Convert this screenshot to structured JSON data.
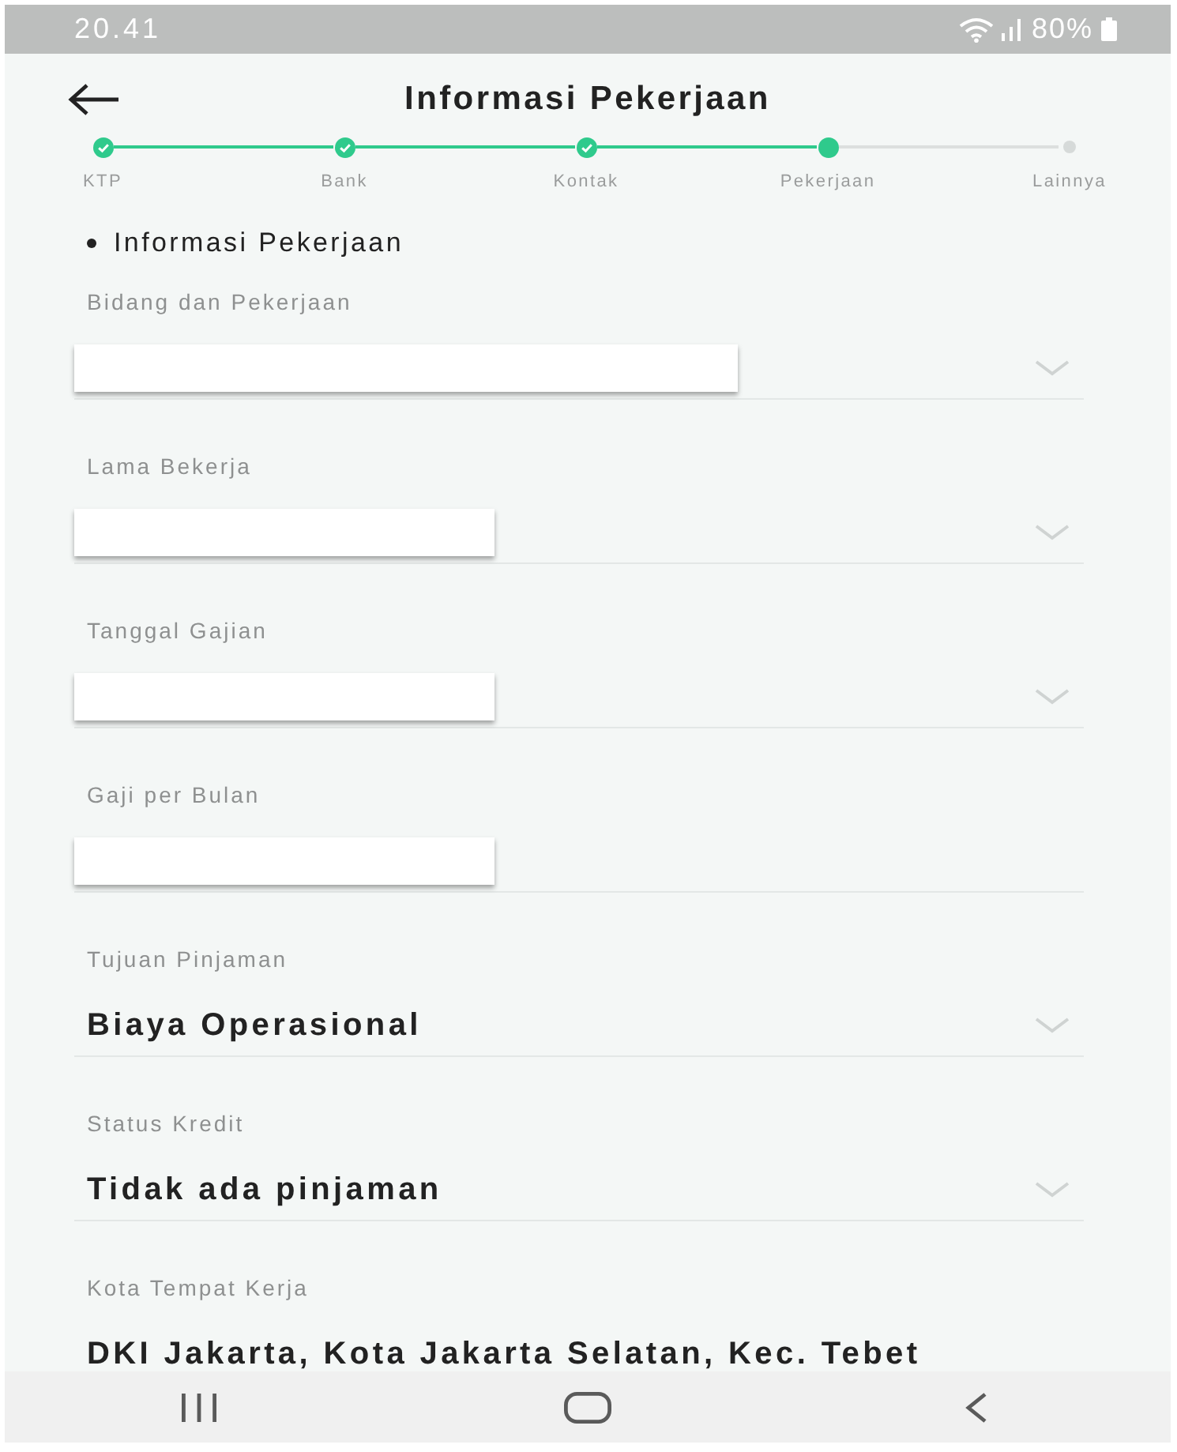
{
  "status_bar": {
    "time": "20.41",
    "battery": "80%"
  },
  "header": {
    "title": "Informasi Pekerjaan"
  },
  "steps": [
    {
      "label": "KTP",
      "kind": "done"
    },
    {
      "label": "Bank",
      "kind": "done"
    },
    {
      "label": "Kontak",
      "kind": "done"
    },
    {
      "label": "Pekerjaan",
      "kind": "current"
    },
    {
      "label": "Lainnya",
      "kind": "pending"
    }
  ],
  "section": {
    "heading": "Informasi Pekerjaan"
  },
  "fields": [
    {
      "label": "Bidang dan Pekerjaan",
      "kind": "dropdown",
      "redacted": true,
      "wide": true
    },
    {
      "label": "Lama Bekerja",
      "kind": "dropdown",
      "redacted": true,
      "wide": false
    },
    {
      "label": "Tanggal Gajian",
      "kind": "dropdown",
      "redacted": true,
      "wide": false
    },
    {
      "label": "Gaji per Bulan",
      "kind": "input",
      "redacted": true,
      "wide": false
    },
    {
      "label": "Tujuan Pinjaman",
      "kind": "dropdown",
      "value": "Biaya Operasional"
    },
    {
      "label": "Status Kredit",
      "kind": "dropdown",
      "value": "Tidak ada pinjaman"
    },
    {
      "label": "Kota Tempat Kerja",
      "kind": "input",
      "value": "DKI Jakarta, Kota Jakarta Selatan, Kec. Tebet"
    }
  ]
}
